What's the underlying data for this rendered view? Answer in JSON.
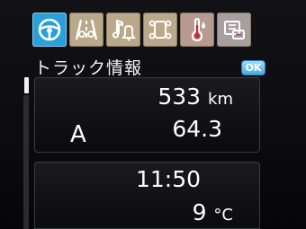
{
  "tabs": [
    {
      "icon": "steering-wheel-icon",
      "active": true
    },
    {
      "icon": "road-lanes-icon",
      "active": false
    },
    {
      "icon": "music-bell-icon",
      "active": false
    },
    {
      "icon": "vehicle-check-icon",
      "active": false
    },
    {
      "icon": "thermometer-drop-icon",
      "active": false
    },
    {
      "icon": "settings-sliders-icon",
      "active": false
    }
  ],
  "header": {
    "title": "トラック情報",
    "ok_label": "OK"
  },
  "panel1": {
    "distance_value": "533",
    "distance_unit": "km",
    "grade": "A",
    "score": "64.3"
  },
  "panel2": {
    "time": "11:50",
    "temperature_value": "9",
    "temperature_unit": "°C"
  },
  "colors": {
    "accent": "#2a9fd8",
    "tab_bg": "#b9a98a",
    "text": "#ffffff",
    "background": "#0c0c10"
  }
}
